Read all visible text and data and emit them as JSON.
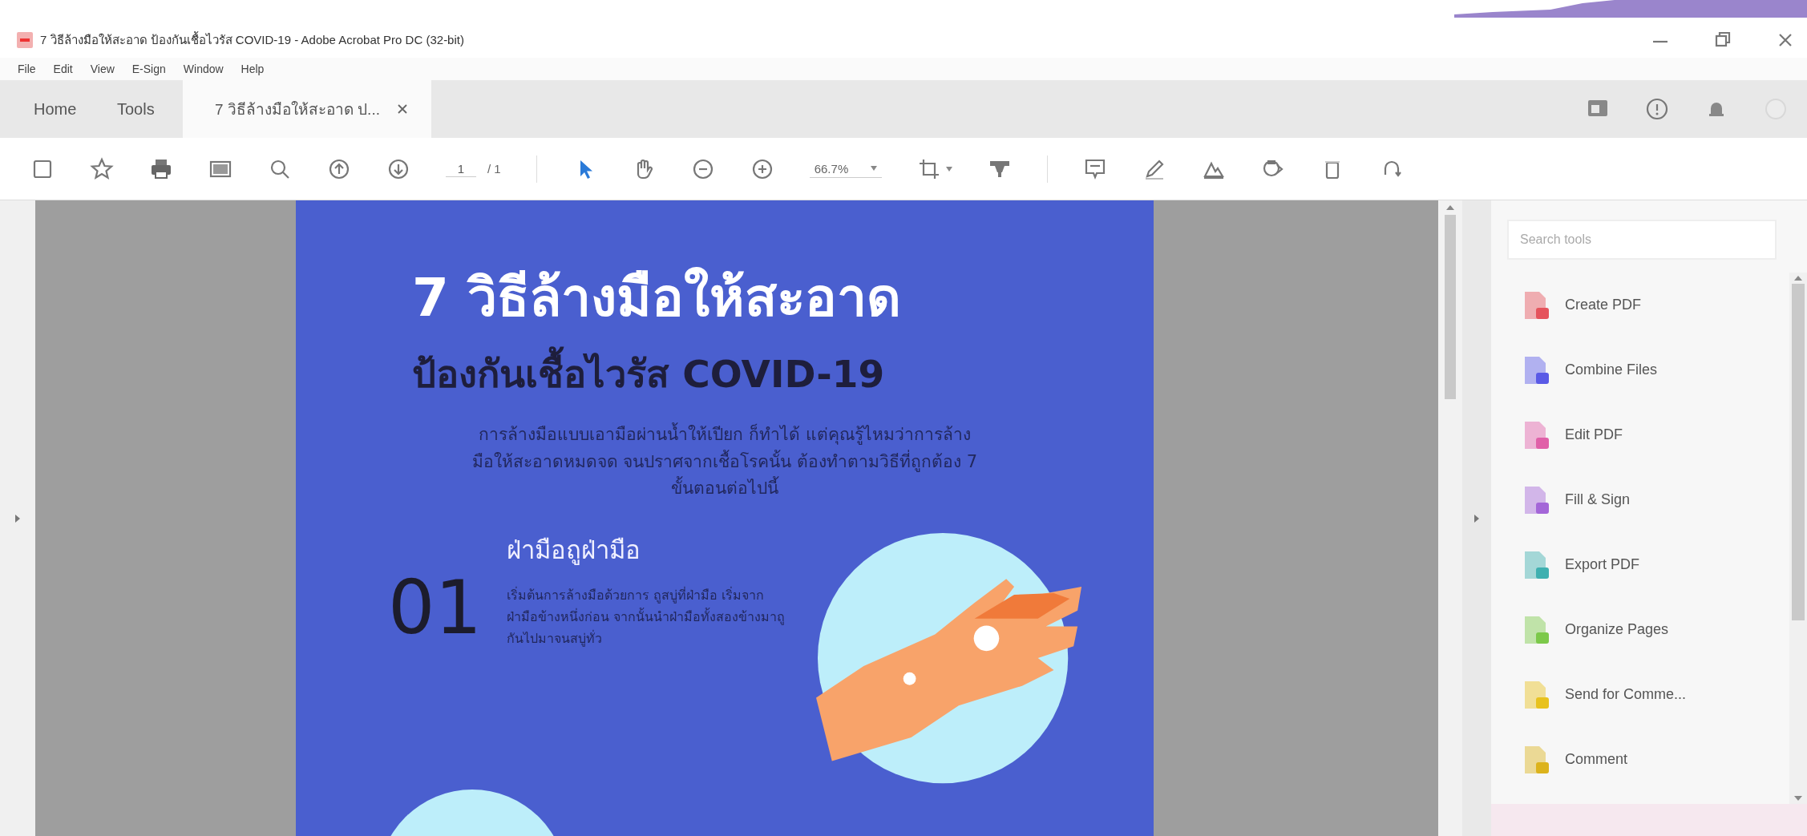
{
  "window": {
    "title": "7 วิธีล้างมือให้สะอาด ป้องกันเชื้อไวรัส COVID-19 - Adobe Acrobat Pro DC (32-bit)"
  },
  "menu": [
    "File",
    "Edit",
    "View",
    "E-Sign",
    "Window",
    "Help"
  ],
  "tabs": [
    {
      "label": "Home",
      "kind": "nav",
      "selected": false
    },
    {
      "label": "Tools",
      "kind": "nav",
      "selected": false
    },
    {
      "label": "7 วิธีล้างมือให้สะอาด ป...",
      "kind": "document",
      "selected": true
    }
  ],
  "toolbar": {
    "page": "1",
    "page_count": "/ 1",
    "zoom": "66.7%"
  },
  "document": {
    "heading": "7 วิธีล้างมือให้สะอาด",
    "subheading": "ป้องกันเชื้อไวรัส COVID-19",
    "intro": "การล้างมือแบบเอามือผ่านน้ำให้เปียก ก็ทำได้ แต่คุณรู้ไหมว่าการล้างมือให้สะอาดหมดจด จนปราศจากเชื้อโรคนั้น ต้องทำตามวิธีที่ถูกต้อง 7 ขั้นตอนต่อไปนี้",
    "steps": [
      {
        "number": "01",
        "title": "ฝ่ามือถูฝ่ามือ",
        "text": "เริ่มต้นการล้างมือด้วยการ ถูสบู่ที่ฝ่ามือ เริ่มจากฝ่ามือข้างหนึ่งก่อน จากนั้นนำฝ่ามือทั้งสองข้างมาถูกันไปมาจนสบู่ทั่ว"
      }
    ]
  },
  "tools_panel": {
    "search": {
      "placeholder": "Search tools"
    },
    "tools": [
      {
        "label": "Create PDF",
        "color": "#e5535c"
      },
      {
        "label": "Combine Files",
        "color": "#5a5ae6"
      },
      {
        "label": "Edit PDF",
        "color": "#e060a8"
      },
      {
        "label": "Fill & Sign",
        "color": "#a466d8"
      },
      {
        "label": "Export PDF",
        "color": "#3fb0b0"
      },
      {
        "label": "Organize Pages",
        "color": "#7cc94a"
      },
      {
        "label": "Send for Comme...",
        "color": "#e8c21e"
      },
      {
        "label": "Comment",
        "color": "#dcb31c"
      }
    ]
  }
}
